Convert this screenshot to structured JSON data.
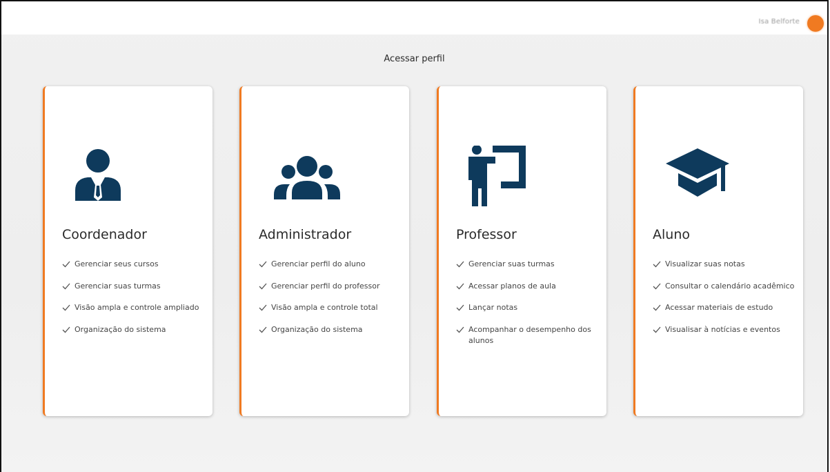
{
  "header": {
    "user_name": "Isa Belforte"
  },
  "page": {
    "title": "Acessar perfil"
  },
  "colors": {
    "accent": "#f07a21",
    "icon": "#0e3a5c"
  },
  "cards": [
    {
      "title": "Coordenador",
      "icon": "businessman-icon",
      "features": [
        "Gerenciar seus cursos",
        "Gerenciar suas turmas",
        "Visão ampla e controle ampliado",
        "Organização do sistema"
      ]
    },
    {
      "title": "Administrador",
      "icon": "users-group-icon",
      "features": [
        "Gerenciar perfil do aluno",
        "Gerenciar perfil do professor",
        "Visão ampla e controle total",
        "Organização do sistema"
      ]
    },
    {
      "title": "Professor",
      "icon": "teacher-board-icon",
      "features": [
        "Gerenciar suas turmas",
        "Acessar planos de aula",
        "Lançar notas",
        "Acompanhar o desempenho dos alunos"
      ]
    },
    {
      "title": "Aluno",
      "icon": "graduation-cap-icon",
      "features": [
        "Visualizar suas notas",
        "Consultar o calendário acadêmico",
        "Acessar materiais de estudo",
        "Visualisar à notícias e eventos"
      ]
    }
  ]
}
